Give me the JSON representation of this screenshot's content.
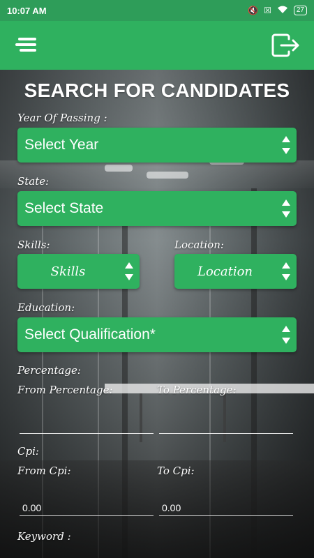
{
  "status_bar": {
    "time": "10:07 AM",
    "battery": "27",
    "icons": [
      "mute-icon",
      "no-sim-icon",
      "wifi-icon",
      "battery-icon"
    ]
  },
  "app_bar": {
    "menu_icon": "menu-icon",
    "logout_icon": "logout-icon",
    "color": "#2fb15f"
  },
  "page": {
    "title": "SEARCH FOR CANDIDATES"
  },
  "form": {
    "year_label": "Year Of Passing :",
    "year_value": "Select Year",
    "state_label": "State:",
    "state_value": "Select State",
    "skills_label": "Skills:",
    "skills_value": "Skills",
    "location_label": "Location:",
    "location_value": "Location",
    "education_label": "Education:",
    "education_value": "Select Qualification*",
    "percentage_label": "Percentage:",
    "from_percentage_label": "From Percentage:",
    "from_percentage_value": "",
    "to_percentage_label": "To Percentage:",
    "to_percentage_value": "",
    "cpi_label": "Cpi:",
    "from_cpi_label": "From Cpi:",
    "from_cpi_value": "0.00",
    "to_cpi_label": "To Cpi:",
    "to_cpi_value": "0.00",
    "keyword_label": "Keyword :"
  }
}
